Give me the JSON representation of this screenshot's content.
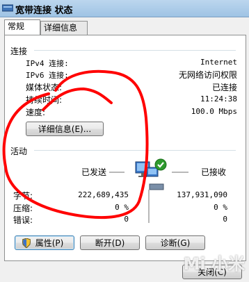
{
  "window": {
    "title": "宽带连接 状态"
  },
  "tabs": [
    {
      "label": "常规"
    },
    {
      "label": "详细信息"
    }
  ],
  "connection": {
    "section": "连接",
    "rows": [
      {
        "label": "IPv4 连接:",
        "value": "Internet"
      },
      {
        "label": "IPv6 连接:",
        "value": "无网络访问权限"
      },
      {
        "label": "媒体状态:",
        "value": "已连接"
      },
      {
        "label": "持续时间:",
        "value": "11:24:38"
      },
      {
        "label": "速度:",
        "value": "100.0 Mbps"
      }
    ],
    "details_button": "详细信息(E)..."
  },
  "activity": {
    "section": "活动",
    "sent_label": "已发送",
    "received_label": "已接收",
    "rows": [
      {
        "label": "字节:",
        "sent": "222,689,435",
        "received": "137,931,090"
      },
      {
        "label": "压缩:",
        "sent": "0 %",
        "received": "0 %"
      },
      {
        "label": "错误:",
        "sent": "0",
        "received": "0"
      }
    ]
  },
  "buttons": {
    "properties": "属性(P)",
    "disconnect": "断开(D)",
    "diagnose": "诊断(G)",
    "close": "关闭(C)"
  },
  "watermark": "Mi 小米",
  "icons": {
    "shield": "shield-icon",
    "network": "network-computer-icon",
    "check": "check-icon"
  },
  "colors": {
    "annotation": "#ff0000",
    "accent": "#1c5180"
  }
}
